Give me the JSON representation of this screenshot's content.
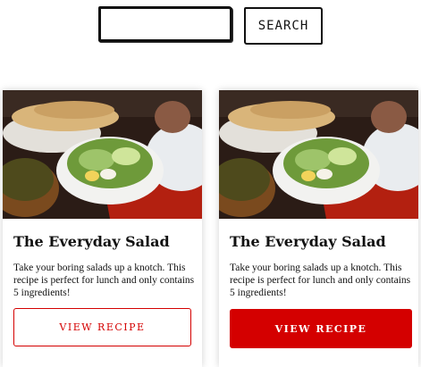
{
  "search": {
    "placeholder": "",
    "value": "",
    "button_label": "SEARCH"
  },
  "cards": [
    {
      "title": "The Everyday Salad",
      "description": "Take your boring salads up a knotch. This recipe is perfect for lunch and only contains 5 ingredients!",
      "button_label": "VIEW RECIPE",
      "image_alt": "salad-photo"
    },
    {
      "title": "The Everyday Salad",
      "description": "Take your boring salads up a knotch. This recipe is perfect for lunch and only contains 5 ingredients!",
      "button_label": "VIEW RECIPE",
      "image_alt": "salad-photo"
    }
  ],
  "colors": {
    "accent": "#d40000",
    "text": "#111111"
  }
}
